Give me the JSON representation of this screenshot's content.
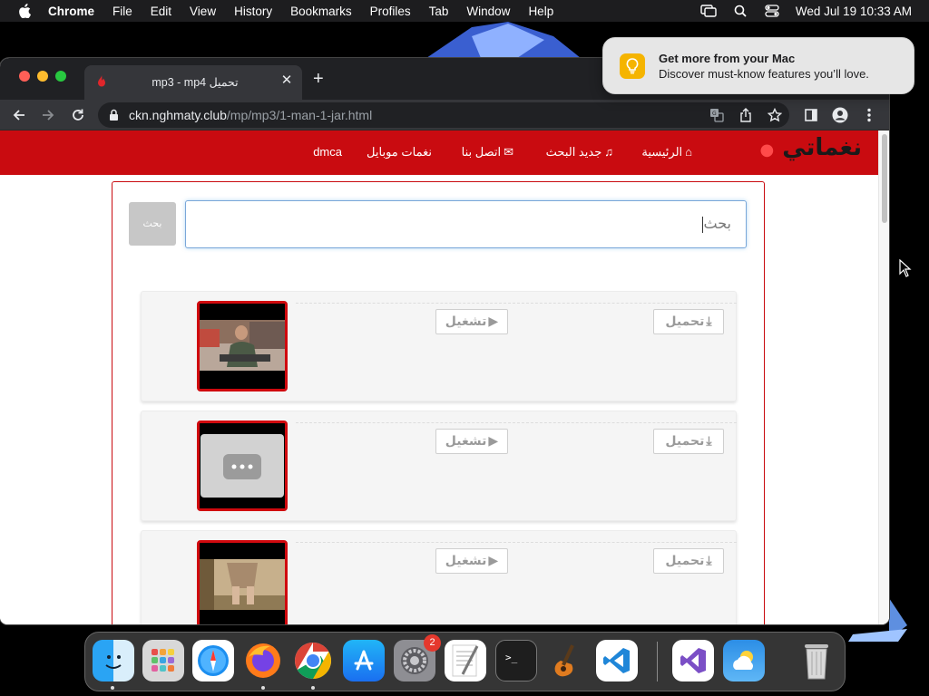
{
  "menubar": {
    "app_name": "Chrome",
    "items": [
      "File",
      "Edit",
      "View",
      "History",
      "Bookmarks",
      "Profiles",
      "Tab",
      "Window",
      "Help"
    ],
    "clock": "Wed Jul 19  10:33 AM",
    "status_icons": [
      "screen-mirroring-icon",
      "spotlight-search-icon",
      "control-center-icon"
    ]
  },
  "notification": {
    "title": "Get more from your Mac",
    "body": "Discover must-know features you’ll love.",
    "icon": "lightbulb-icon",
    "icon_color": "#f5b400"
  },
  "browser": {
    "tab": {
      "title": "mp3 - mp4 تحميل",
      "favicon": "flame-icon"
    },
    "address": {
      "host": "ckn.nghmaty.club",
      "path": "/mp/mp3/1-man-1-jar.html"
    }
  },
  "site": {
    "accent_color": "#c90b10",
    "logo_text": "نغماتي",
    "nav": [
      {
        "label": "الرئيسية",
        "icon": "home-icon"
      },
      {
        "label": "جديد البحث",
        "icon": "music-icon"
      },
      {
        "label": "اتصل بنا",
        "icon": "envelope-icon"
      },
      {
        "label": "نغمات موبايل",
        "icon": ""
      },
      {
        "label": "dmca",
        "icon": ""
      }
    ],
    "search": {
      "placeholder": "بحث",
      "button_label": "بحث"
    },
    "results": [
      {
        "play_label": "تشغيل",
        "download_label": "تحميل",
        "thumb": "man-sitting-video-thumbnail"
      },
      {
        "play_label": "تشغيل",
        "download_label": "تحميل",
        "thumb": "placeholder-video-thumbnail"
      },
      {
        "play_label": "تشغيل",
        "download_label": "تحميل",
        "thumb": "legs-room-video-thumbnail"
      }
    ]
  },
  "dock": {
    "apps": [
      "Finder",
      "Launchpad",
      "Safari",
      "Firefox",
      "Google Chrome",
      "App Store",
      "System Settings",
      "TextEdit",
      "Terminal",
      "GarageBand",
      "Visual Studio Code",
      "Visual Studio",
      "Weather",
      "Trash"
    ],
    "settings_badge": "2"
  }
}
